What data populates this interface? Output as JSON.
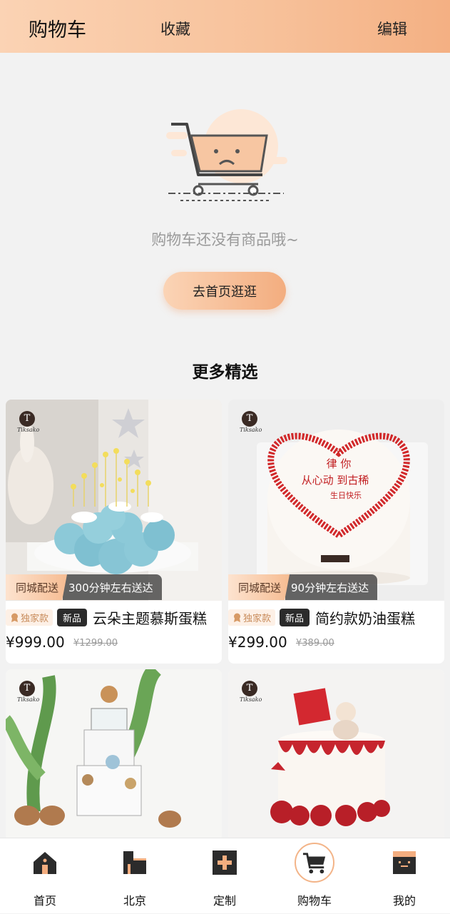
{
  "header": {
    "title": "购物车",
    "favorites": "收藏",
    "edit": "编辑"
  },
  "empty": {
    "message": "购物车还没有商品哦~",
    "button": "去首页逛逛"
  },
  "more": {
    "title": "更多精选"
  },
  "products": [
    {
      "delivery_tag": "同城配送",
      "eta": "300分钟左右送达",
      "exclusive": "独家款",
      "new": "新品",
      "name": "云朵主题慕斯蛋糕",
      "price": "¥999.00",
      "old_price": "¥1299.00"
    },
    {
      "delivery_tag": "同城配送",
      "eta": "90分钟左右送达",
      "exclusive": "独家款",
      "new": "新品",
      "name": "简约款奶油蛋糕",
      "price": "¥299.00",
      "old_price": "¥389.00"
    }
  ],
  "logo_text": "Tiksako",
  "tabs": [
    {
      "label": "首页",
      "icon": "home-icon"
    },
    {
      "label": "北京",
      "icon": "city-icon"
    },
    {
      "label": "定制",
      "icon": "plus-icon"
    },
    {
      "label": "购物车",
      "icon": "cart-icon",
      "active": true
    },
    {
      "label": "我的",
      "icon": "profile-icon"
    }
  ],
  "colors": {
    "accent_light": "#fbd3b4",
    "accent_dark": "#f3ad7f",
    "dark": "#2b2b2b"
  }
}
